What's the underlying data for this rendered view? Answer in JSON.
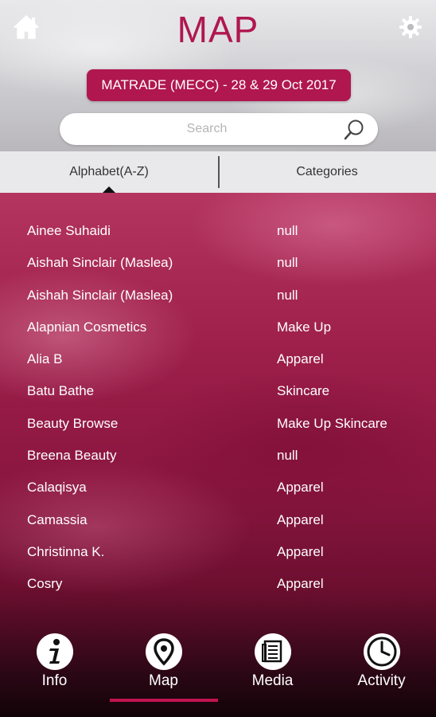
{
  "header": {
    "title": "MAP",
    "home_icon": "home-icon",
    "settings_icon": "gear-icon"
  },
  "event": {
    "label": "MATRADE (MECC) - 28 & 29 Oct 2017"
  },
  "search": {
    "placeholder": "Search",
    "value": ""
  },
  "tabs": [
    {
      "label": "Alphabet(A-Z)",
      "active": true
    },
    {
      "label": "Categories",
      "active": false
    }
  ],
  "list": [
    {
      "name": "Ainee Suhaidi",
      "category": "null"
    },
    {
      "name": "Aishah Sinclair (Maslea)",
      "category": "null"
    },
    {
      "name": "Aishah Sinclair (Maslea)",
      "category": "null"
    },
    {
      "name": "Alapnian Cosmetics",
      "category": "Make Up"
    },
    {
      "name": "Alia B",
      "category": "Apparel"
    },
    {
      "name": "Batu Bathe",
      "category": "Skincare"
    },
    {
      "name": "Beauty Browse",
      "category": "Make Up Skincare"
    },
    {
      "name": "Breena Beauty",
      "category": "null"
    },
    {
      "name": "Calaqisya",
      "category": "Apparel"
    },
    {
      "name": "Camassia",
      "category": "Apparel"
    },
    {
      "name": "Christinna K.",
      "category": "Apparel"
    },
    {
      "name": "Cosry",
      "category": "Apparel"
    }
  ],
  "bottom_nav": {
    "items": [
      {
        "label": "Info",
        "icon": "info-icon"
      },
      {
        "label": "Map",
        "icon": "map-pin-icon"
      },
      {
        "label": "Media",
        "icon": "newspaper-icon"
      },
      {
        "label": "Activity",
        "icon": "clock-icon"
      }
    ],
    "active_index": 1
  },
  "colors": {
    "accent": "#b0174f",
    "tab_bar": "#e9e9eb",
    "indicator": "#c0134f"
  }
}
